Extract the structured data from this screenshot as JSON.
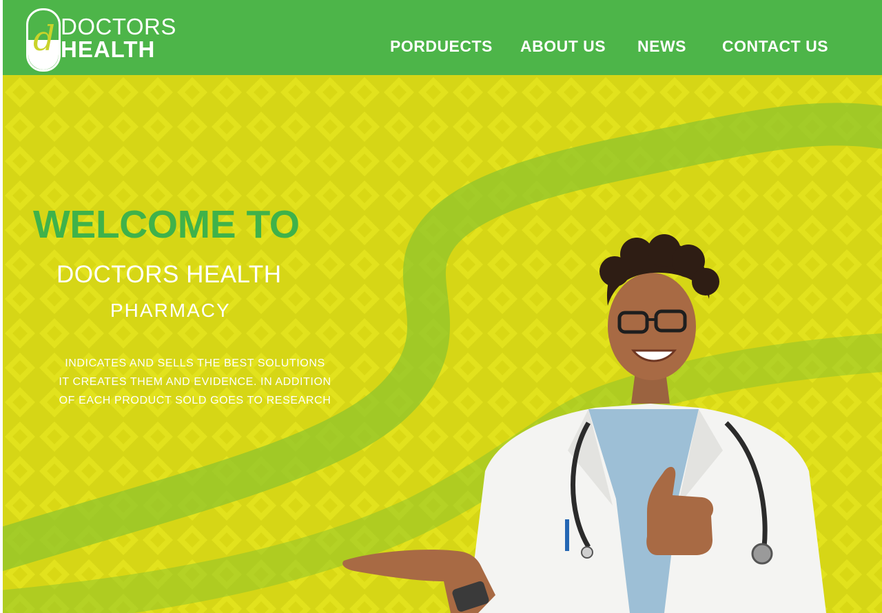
{
  "brand": {
    "logo_mark": "d",
    "name_line1": "DOCTORS",
    "name_line2": "HEALTH"
  },
  "nav": {
    "items": [
      {
        "label": "PORDUECTS"
      },
      {
        "label": "ABOUT US"
      },
      {
        "label": "NEWS"
      },
      {
        "label": "CONTACT US"
      }
    ]
  },
  "hero": {
    "welcome": "WELCOME TO",
    "brand_line": "DOCTORS HEALTH",
    "subtitle": "PHARMACY",
    "blurb": [
      "INDICATES AND SELLS THE BEST SOLUTIONS",
      "IT CREATES THEM AND EVIDENCE. IN ADDITION",
      "OF EACH PRODUCT SOLD GOES TO RESEARCH"
    ]
  },
  "colors": {
    "nav_bg": "#4db549",
    "hero_bg": "#d6d616",
    "accent_green": "#3fb24a",
    "text_white": "#ffffff"
  }
}
